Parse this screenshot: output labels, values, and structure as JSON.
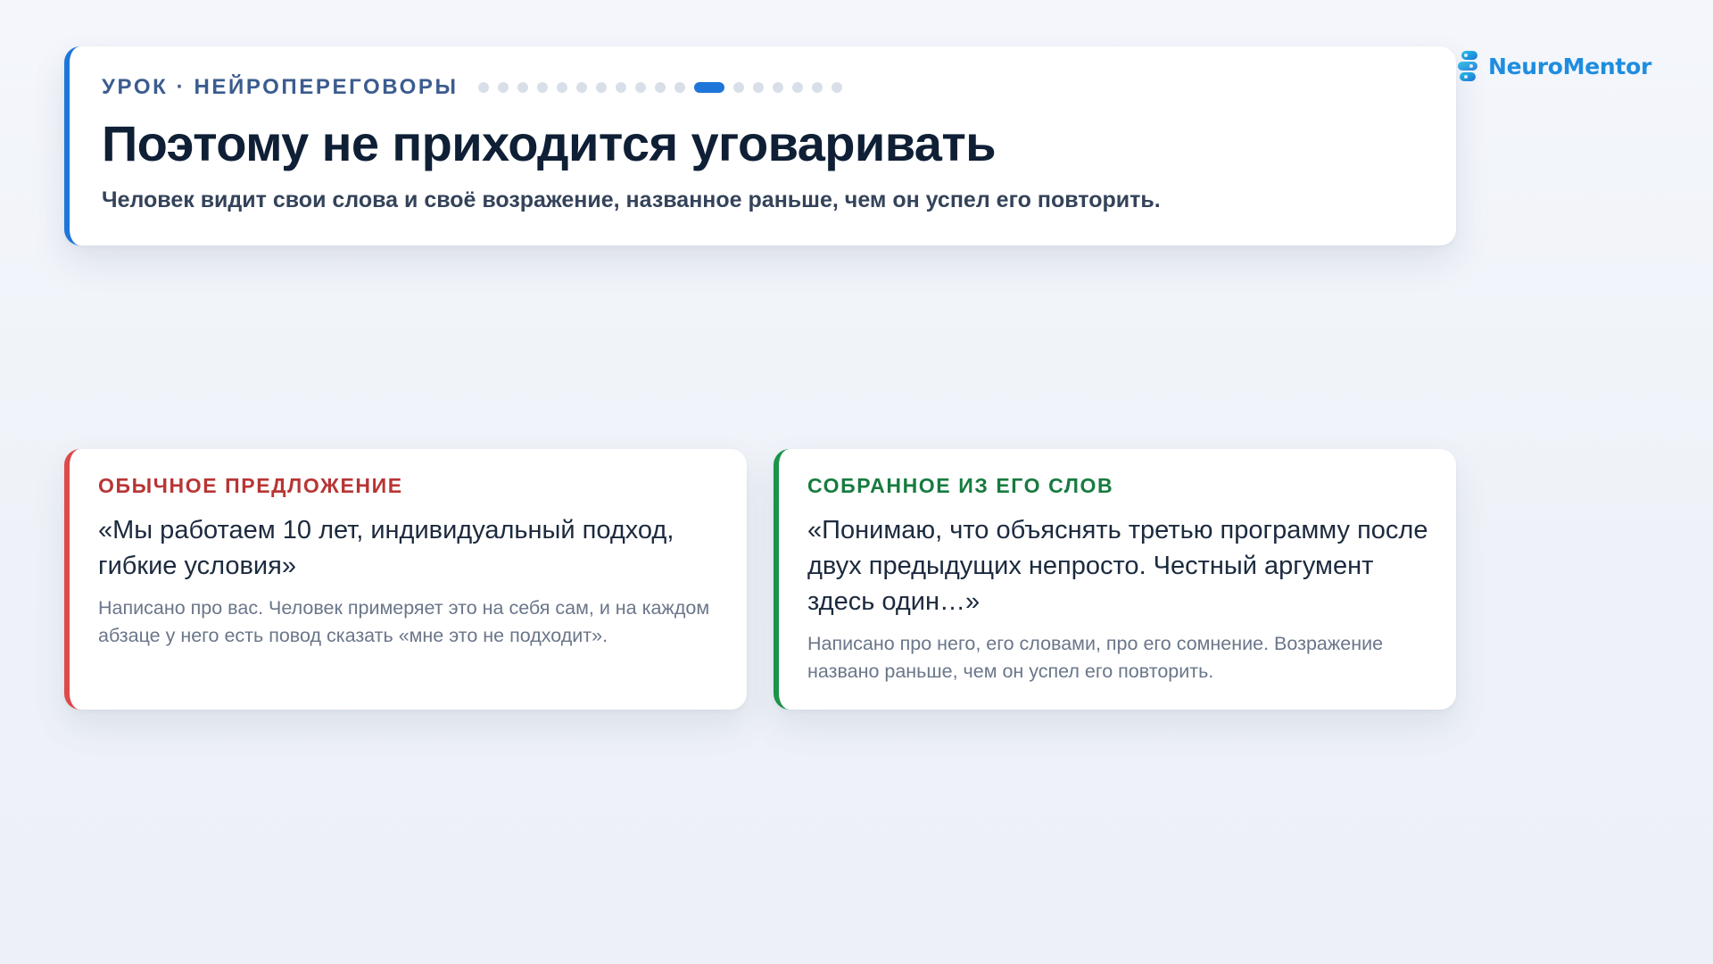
{
  "brand": {
    "name": "NeuroMentor",
    "icon": "neuromentor-logo-icon",
    "color": "#1e8de0"
  },
  "header": {
    "lesson_label": "УРОК · НЕЙРОПЕРЕГОВОРЫ",
    "progress": {
      "total_slides": 18,
      "current_slide": 12
    },
    "title": "Поэтому не приходится уговаривать",
    "subtitle": "Человек видит свои слова и своё возражение, названное раньше, чем он успел его повторить.",
    "accent_color": "#1e76d9"
  },
  "cards": [
    {
      "kicker": "ОБЫЧНОЕ ПРЕДЛОЖЕНИЕ",
      "quote": "«Мы работаем 10 лет, индивидуальный подход, гибкие условия»",
      "note": "Написано про вас. Человек примеряет это на себя сам, и на каждом абзаце у него есть повод сказать «мне это не подходит».",
      "accent_color": "#dc4a4a"
    },
    {
      "kicker": "СОБРАННОЕ ИЗ ЕГО СЛОВ",
      "quote": "«Понимаю, что объяснять третью программу после двух предыдущих непросто. Честный аргумент здесь один…»",
      "note": "Написано про него, его словами, про его сомнение. Возражение названо раньше, чем он успел его повторить.",
      "accent_color": "#1a9448"
    }
  ]
}
